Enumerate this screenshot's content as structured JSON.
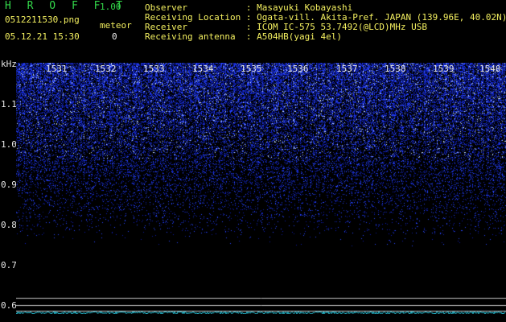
{
  "app": {
    "title": "H R O F F T",
    "version": "1.00"
  },
  "file": {
    "name": "0512211530.png",
    "datetime": "05.12.21 15:30"
  },
  "meteor": {
    "label": "meteor",
    "count": "0"
  },
  "info": {
    "observer": "Observer           : Masayuki Kobayashi",
    "location": "Receiving Location : Ogata-vill. Akita-Pref. JAPAN (139.96E, 40.02N)",
    "receiver": "Receiver           : ICOM IC-575 53.7492(@LCD)MHz USB",
    "antenna": "Receiving antenna  : A504HB(yagi 4el)"
  },
  "axis": {
    "unit": "kHz",
    "y_ticks": [
      "1.1",
      "1.0",
      "0.9",
      "0.8",
      "0.7",
      "0.6"
    ],
    "x_ticks": [
      "1531",
      "1532",
      "1533",
      "1534",
      "1535",
      "1536",
      "1537",
      "1538",
      "1539",
      "1540"
    ]
  },
  "colors": {
    "signal": "#3a5cff",
    "bright": "#d8e8ff",
    "baseline": "#2ad0e8",
    "grid": "#bfbfbf"
  }
}
